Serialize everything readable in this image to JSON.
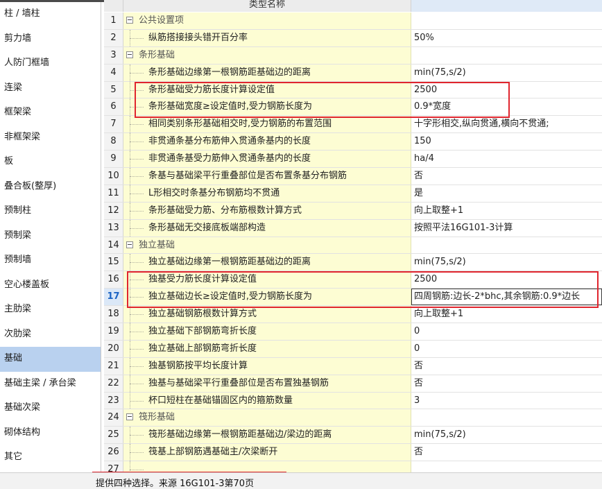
{
  "grid": {
    "header": {
      "name": "类型名称",
      "value": ""
    },
    "rows": [
      {
        "num": "1",
        "name": "公共设置项",
        "value": "",
        "group": true
      },
      {
        "num": "2",
        "name": "纵筋搭接接头错开百分率",
        "value": "50%"
      },
      {
        "num": "3",
        "name": "条形基础",
        "value": "",
        "group": true
      },
      {
        "num": "4",
        "name": "条形基础边缘第一根钢筋距基础边的距离",
        "value": "min(75,s/2)"
      },
      {
        "num": "5",
        "name": "条形基础受力筋长度计算设定值",
        "value": "2500"
      },
      {
        "num": "6",
        "name": "条形基础宽度≥设定值时,受力钢筋长度为",
        "value": "0.9*宽度"
      },
      {
        "num": "7",
        "name": "相同类别条形基础相交时,受力钢筋的布置范围",
        "value": "十字形相交,纵向贯通,横向不贯通;"
      },
      {
        "num": "8",
        "name": "非贯通条基分布筋伸入贯通条基内的长度",
        "value": "150"
      },
      {
        "num": "9",
        "name": "非贯通条基受力筋伸入贯通条基内的长度",
        "value": "ha/4"
      },
      {
        "num": "10",
        "name": "条基与基础梁平行重叠部位是否布置条基分布钢筋",
        "value": "否"
      },
      {
        "num": "11",
        "name": "L形相交时条基分布钢筋均不贯通",
        "value": "是"
      },
      {
        "num": "12",
        "name": "条形基础受力筋、分布筋根数计算方式",
        "value": "向上取整+1"
      },
      {
        "num": "13",
        "name": "条形基础无交接底板端部构造",
        "value": "按照平法16G101-3计算"
      },
      {
        "num": "14",
        "name": "独立基础",
        "value": "",
        "group": true
      },
      {
        "num": "15",
        "name": "独立基础边缘第一根钢筋距基础边的距离",
        "value": "min(75,s/2)"
      },
      {
        "num": "16",
        "name": "独基受力筋长度计算设定值",
        "value": "2500"
      },
      {
        "num": "17",
        "name": "独立基础边长≥设定值时,受力钢筋长度为",
        "value": "四周钢筋:边长-2*bhc,其余钢筋:0.9*边长",
        "current": true
      },
      {
        "num": "18",
        "name": "独立基础钢筋根数计算方式",
        "value": "向上取整+1"
      },
      {
        "num": "19",
        "name": "独立基础下部钢筋弯折长度",
        "value": "0"
      },
      {
        "num": "20",
        "name": "独立基础上部钢筋弯折长度",
        "value": "0"
      },
      {
        "num": "21",
        "name": "独基钢筋按平均长度计算",
        "value": "否"
      },
      {
        "num": "22",
        "name": "独基与基础梁平行重叠部位是否布置独基钢筋",
        "value": "否"
      },
      {
        "num": "23",
        "name": "杯口短柱在基础锚固区内的箍筋数量",
        "value": "3"
      },
      {
        "num": "24",
        "name": "筏形基础",
        "value": "",
        "group": true
      },
      {
        "num": "25",
        "name": "筏形基础边缘第一根钢筋距基础边/梁边的距离",
        "value": "min(75,s/2)"
      },
      {
        "num": "26",
        "name": "筏基上部钢筋遇基础主/次梁断开",
        "value": "否"
      },
      {
        "num": "27",
        "name": "",
        "value": ""
      }
    ]
  },
  "sidebar": {
    "items": [
      {
        "label": "柱 / 墙柱"
      },
      {
        "label": "剪力墙"
      },
      {
        "label": "人防门框墙"
      },
      {
        "label": "连梁"
      },
      {
        "label": "框架梁"
      },
      {
        "label": "非框架梁"
      },
      {
        "label": "板"
      },
      {
        "label": "叠合板(整厚)"
      },
      {
        "label": "预制柱"
      },
      {
        "label": "预制梁"
      },
      {
        "label": "预制墙"
      },
      {
        "label": "空心楼盖板"
      },
      {
        "label": "主肋梁"
      },
      {
        "label": "次肋梁"
      },
      {
        "label": "基础",
        "selected": true
      },
      {
        "label": "基础主梁 / 承台梁"
      },
      {
        "label": "基础次梁"
      },
      {
        "label": "砌体结构"
      },
      {
        "label": "其它"
      }
    ]
  },
  "status": {
    "text": "提供四种选择。来源 16G101-3第70页"
  },
  "colors": {
    "selected_bg": "#b9d1ef",
    "name_cell_bg": "#fdfdd3",
    "highlight_box": "#e0252e"
  }
}
